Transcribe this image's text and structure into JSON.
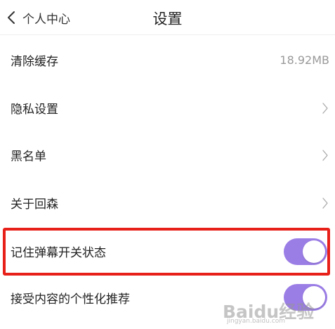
{
  "header": {
    "back_label": "个人中心",
    "title": "设置"
  },
  "settings": {
    "clear_cache": {
      "label": "清除缓存",
      "value": "18.92MB"
    },
    "privacy": {
      "label": "隐私设置"
    },
    "blacklist": {
      "label": "黑名单"
    },
    "about": {
      "label": "关于回森"
    },
    "remember_danmaku": {
      "label": "记住弹幕开关状态",
      "enabled": true
    },
    "personalized": {
      "label": "接受内容的个性化推荐",
      "enabled": true
    }
  },
  "watermark": {
    "logo_text": "Baidu经验",
    "url": "jingyan.baidu.com"
  },
  "colors": {
    "toggle_on": "#9b7de6",
    "highlight_border": "#e8201a",
    "value_text": "#999999"
  },
  "icons": {
    "back": "chevron-left-icon",
    "row_arrow": "chevron-right-icon"
  }
}
